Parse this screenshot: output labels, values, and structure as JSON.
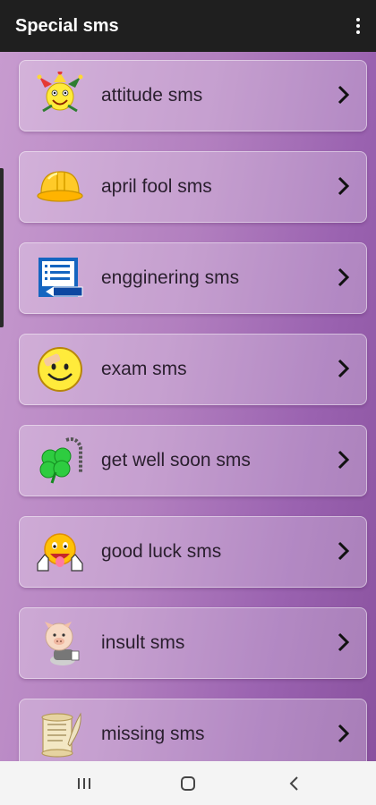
{
  "app": {
    "title": "Special sms"
  },
  "items": [
    {
      "label": "attitude sms",
      "icon": "jester-smiley-icon"
    },
    {
      "label": "april fool sms",
      "icon": "hard-hat-icon"
    },
    {
      "label": "engginering sms",
      "icon": "document-pencil-icon"
    },
    {
      "label": "exam sms",
      "icon": "bandaged-smiley-icon"
    },
    {
      "label": "get well soon sms",
      "icon": "clover-card-icon"
    },
    {
      "label": "good luck sms",
      "icon": "thumbs-up-smiley-icon"
    },
    {
      "label": "insult sms",
      "icon": "cartoon-pig-icon"
    },
    {
      "label": "missing sms",
      "icon": "scroll-quill-icon"
    }
  ],
  "colors": {
    "appbar": "#1f1f1f",
    "list_gradient_start": "#c79bcf",
    "list_gradient_end": "#8a529f",
    "navbar": "#f4f4f4"
  },
  "navbar": {
    "buttons": [
      "recent-apps-icon",
      "home-icon",
      "back-icon"
    ]
  }
}
